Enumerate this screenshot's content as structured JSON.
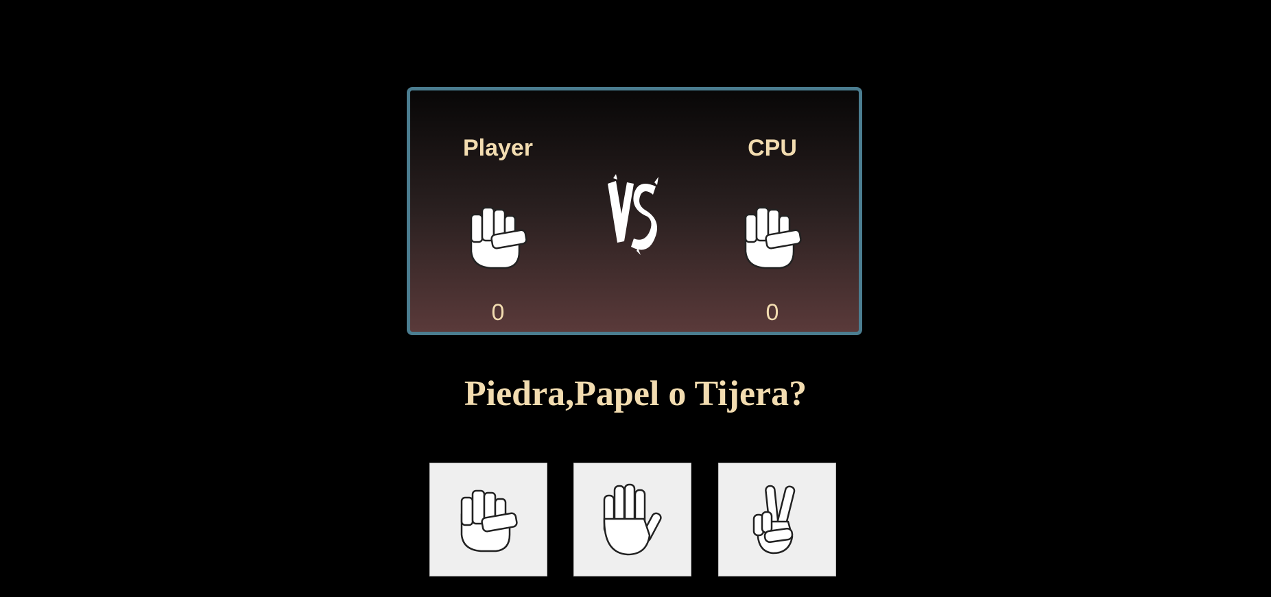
{
  "scoreboard": {
    "player_label": "Player",
    "cpu_label": "CPU",
    "player_score": "0",
    "cpu_score": "0",
    "player_hand_icon": "rock-icon",
    "cpu_hand_icon": "rock-icon",
    "vs_text": "VS"
  },
  "prompt": "Piedra,Papel o Tijera?",
  "choices": [
    {
      "name": "Piedra",
      "icon": "rock-icon"
    },
    {
      "name": "Papel",
      "icon": "paper-icon"
    },
    {
      "name": "Tijera",
      "icon": "scissors-icon"
    }
  ],
  "colors": {
    "background": "#000000",
    "text": "#f2dcb0",
    "board_border": "#4b7d90",
    "board_gradient_top": "#080707",
    "board_gradient_bottom": "#5a3a3a",
    "button_bg": "#efefef"
  }
}
